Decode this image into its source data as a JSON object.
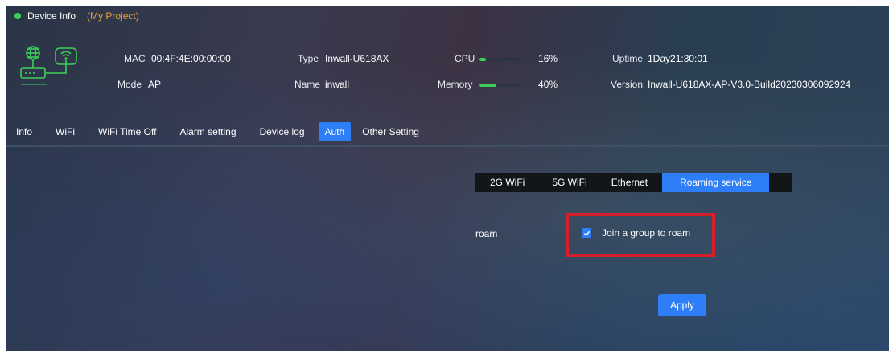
{
  "colors": {
    "status_dot": "#3ecf5a",
    "project": "#e6a23c",
    "accent": "#2d7ef7",
    "cpu_fill": "#3ecf5a",
    "mem_fill": "#3ecf5a",
    "highlight": "#d4202a",
    "icon_green": "#3ecf5a"
  },
  "header": {
    "title": "Device Info",
    "project": "(My Project)"
  },
  "device": {
    "icon": "router-wifi-icon",
    "mac_label": "MAC",
    "mac_value": "00:4F:4E:00:00:00",
    "mode_label": "Mode",
    "mode_value": "AP",
    "type_label": "Type",
    "type_value": "Inwall-U618AX",
    "name_label": "Name",
    "name_value": "inwall",
    "cpu_label": "CPU",
    "cpu_value": "16%",
    "cpu_percent": 16,
    "memory_label": "Memory",
    "memory_value": "40%",
    "memory_percent": 40,
    "uptime_label": "Uptime",
    "uptime_value": "1Day21:30:01",
    "version_label": "Version",
    "version_value": "Inwall-U618AX-AP-V3.0-Build20230306092924"
  },
  "nav": {
    "tabs": [
      {
        "label": "Info"
      },
      {
        "label": "WiFi"
      },
      {
        "label": "WiFi Time Off"
      },
      {
        "label": "Alarm setting"
      },
      {
        "label": "Device log"
      },
      {
        "label": "Auth",
        "active": true
      },
      {
        "label": "Other Setting"
      }
    ]
  },
  "subtabs": [
    {
      "label": "2G WiFi"
    },
    {
      "label": "5G WiFi"
    },
    {
      "label": "Ethernet"
    },
    {
      "label": "Roaming service",
      "active": true
    }
  ],
  "roam": {
    "label": "roam",
    "checkbox_label": "Join a group to roam",
    "checked": true
  },
  "apply_label": "Apply"
}
